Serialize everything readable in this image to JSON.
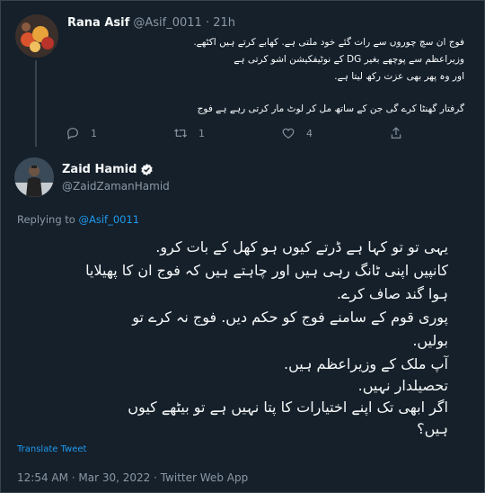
{
  "reply_tweet": {
    "author_name": "Rana Asif",
    "author_handle": "@Asif_0011",
    "separator": "·",
    "time_ago": "21h",
    "lines": [
      "فوج ان سچ چوروں سے رات گئے خود ملتی ہے. کھابے کرتے ہیں اکٹھے.",
      "وزیراعظم سے پوچھے بغیر DG کے نوٹیفکیشن اشو کرتی ہے",
      "اور وہ پھر بھی عزت رکھ لیتا ہے.",
      "گرفتار گھنٹا کرے گی جن کے ساتھ مل کر لوٹ مار کرتی رہے ہے فوج"
    ],
    "reply_count": "1",
    "retweet_count": "1",
    "like_count": "4"
  },
  "main_tweet": {
    "author_name": "Zaid Hamid",
    "author_handle": "@ZaidZamanHamid",
    "replying_to_label": "Replying to",
    "replying_to_handle": "@Asif_0011",
    "lines": [
      "یہی تو تو کہا ہے ڈرتے کیوں ہو کھل کے بات کرو.",
      "کانپیں اپنی ٹانگ رہی ہیں اور چاہتے ہیں کہ فوج ان کا پھیلایا",
      "ہوا گند صاف کرے.",
      "پوری قوم کے سامنے فوج کو حکم  دیں. فوج نہ کرے تو",
      "بولیں.",
      "آپ ملک کے وزیراعظم ہیں.",
      " تحصیلدار نہیں.",
      "اگر ابھی تک اپنے اختیارات کا پتا نہیں ہے تو بیٹھے کیوں",
      "ہیں؟"
    ],
    "translate_label": "Translate Tweet",
    "timestamp": "12:54 AM · Mar 30, 2022 · Twitter Web App"
  },
  "colors": {
    "background": "#15202b",
    "text": "#f7f9f9",
    "muted": "#8b98a5",
    "accent": "#1d9bf0"
  }
}
